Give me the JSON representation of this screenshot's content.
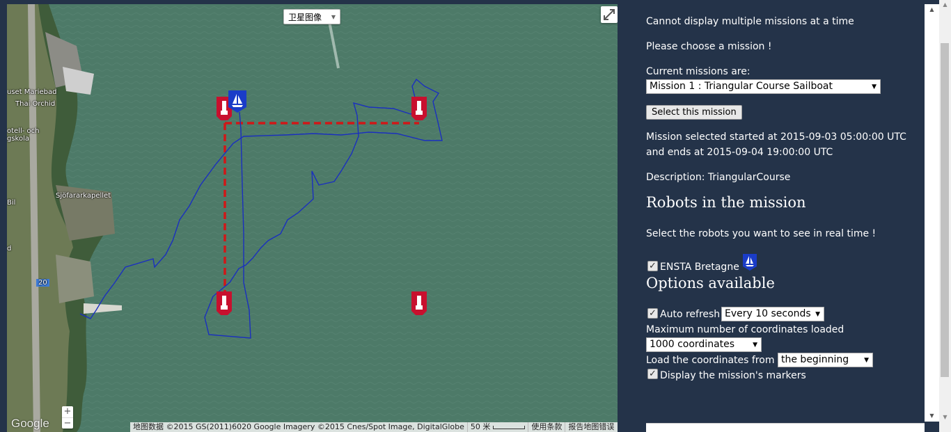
{
  "map": {
    "map_type_label": "卫星图像",
    "zoom_in": "+",
    "zoom_out": "−",
    "logo": "Google",
    "attribution": "地图数据 ©2015 GS(2011)6020 Google Imagery ©2015 Cnes/Spot Image, DigitalGlobe",
    "scale_label": "50 米",
    "terms": "使用条款",
    "report": "报告地图错误",
    "places": {
      "mariebad": "uset Mariebad",
      "thai": "Thai Orchid",
      "hotell": "otell- och",
      "gskola": "gskola",
      "sjofarks": "Sjöfararkapellet",
      "bil": "Bil",
      "d": "d",
      "road": "20"
    },
    "colors": {
      "water": "#4b7866",
      "track": "#1a2fbf",
      "course": "#d01818",
      "marker": "#c8102e",
      "robot": "#1a3cc8"
    }
  },
  "panel": {
    "line1": "Cannot display multiple missions at a time",
    "line2": "Please choose a mission !",
    "current_label": "Current missions are:",
    "mission_select": "Mission 1 : Triangular Course Sailboat",
    "select_button": "Select this mission",
    "started": "Mission selected started at 2015-09-03 05:00:00 UTC",
    "ends": "and ends at 2015-09-04 19:00:00 UTC",
    "description": "Description: TriangularCourse",
    "robots_heading": "Robots in the mission",
    "robots_hint": "Select the robots you want to see in real time !",
    "robot_name": "ENSTA Bretagne",
    "options_heading": "Options available",
    "auto_refresh_label": "Auto refresh",
    "auto_refresh_value": "Every 10 seconds",
    "max_coords_label": "Maximum number of coordinates loaded",
    "max_coords_value": "1000 coordinates",
    "load_from_label": "Load the coordinates from",
    "load_from_value": "the beginning",
    "display_markers_label": "Display the mission's markers"
  }
}
